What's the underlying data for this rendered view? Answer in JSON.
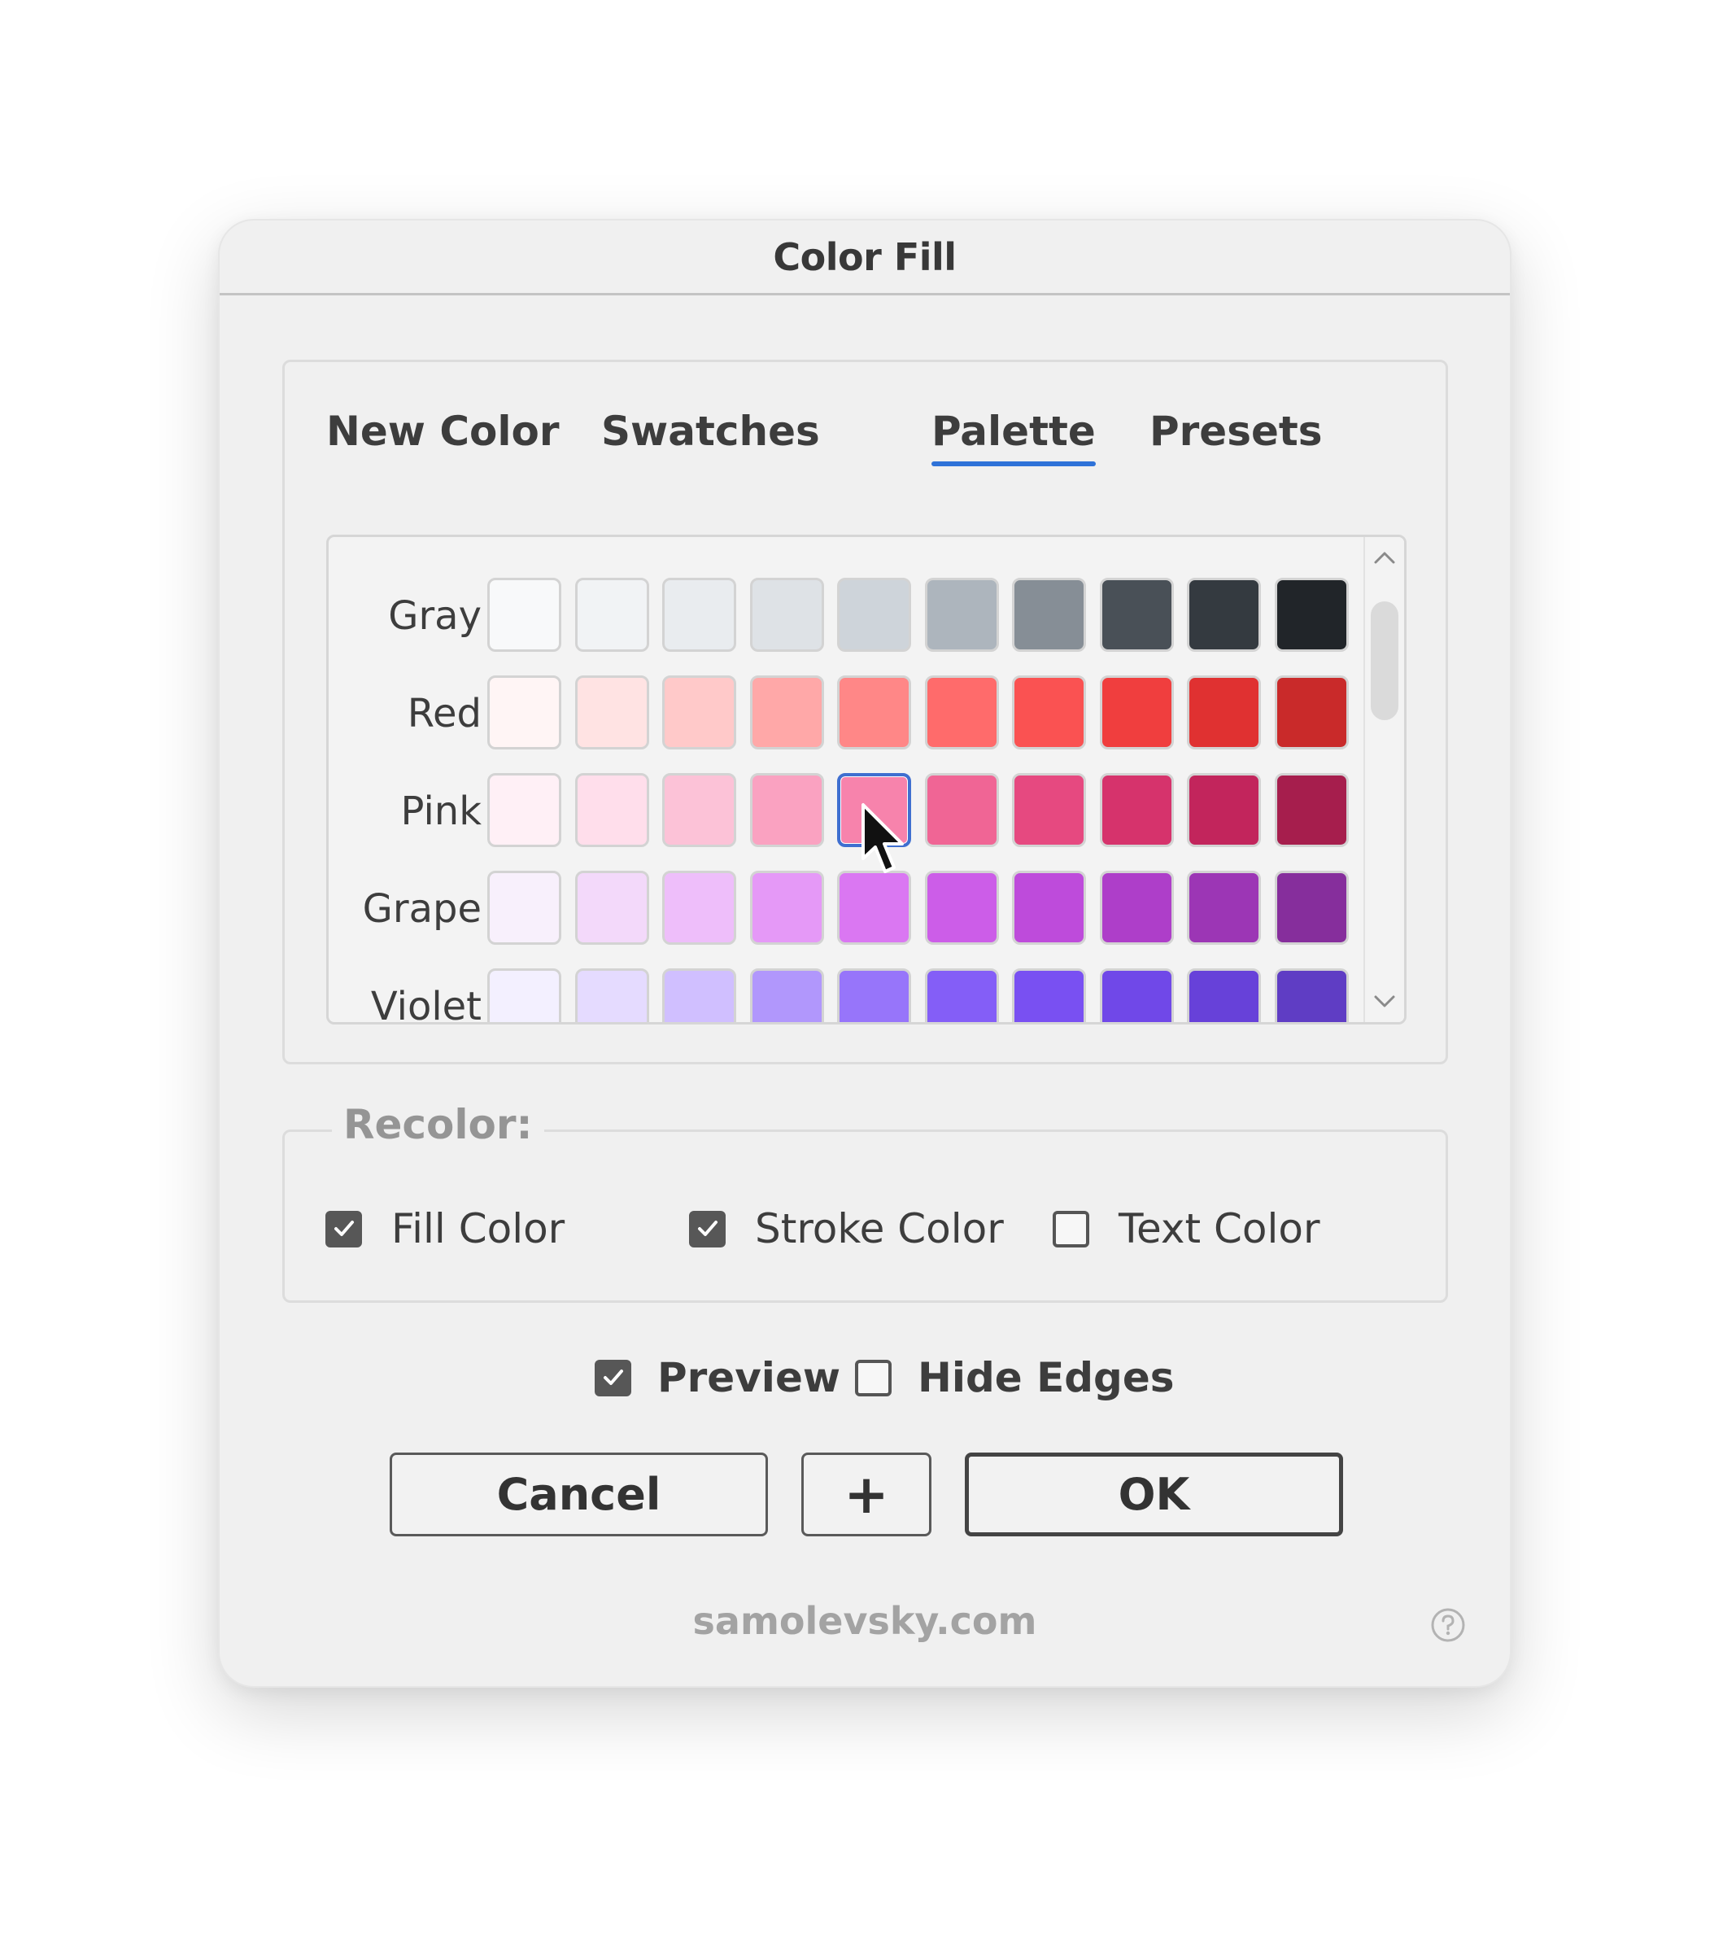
{
  "dialog": {
    "title": "Color Fill"
  },
  "tabs": [
    {
      "label": "New Color",
      "active": false
    },
    {
      "label": "Swatches",
      "active": false
    },
    {
      "label": "Palette",
      "active": true
    },
    {
      "label": "Presets",
      "active": false
    }
  ],
  "palette": {
    "rows": [
      {
        "name": "Gray",
        "colors": [
          "#f8f9fa",
          "#f1f3f5",
          "#e9ecef",
          "#dee2e6",
          "#ced4da",
          "#adb5bd",
          "#868e96",
          "#495057",
          "#343a40",
          "#212529"
        ]
      },
      {
        "name": "Red",
        "colors": [
          "#fff5f5",
          "#ffe3e3",
          "#ffc9c9",
          "#ffa8a8",
          "#ff8787",
          "#ff6b6b",
          "#fa5252",
          "#f03e3e",
          "#e03131",
          "#c92a2a"
        ]
      },
      {
        "name": "Pink",
        "colors": [
          "#fff0f6",
          "#ffdeeb",
          "#fcc2d7",
          "#faa2c1",
          "#f783ac",
          "#f06595",
          "#e64980",
          "#d6336c",
          "#c2255c",
          "#a61e4d"
        ]
      },
      {
        "name": "Grape",
        "colors": [
          "#f8f0fc",
          "#f3d9fa",
          "#eebefa",
          "#e599f7",
          "#da77f2",
          "#cc5de8",
          "#be4bdb",
          "#ae3ec9",
          "#9c36b5",
          "#862e9c"
        ]
      },
      {
        "name": "Violet",
        "colors": [
          "#f3f0ff",
          "#e5dbff",
          "#d0bfff",
          "#b197fc",
          "#9775fa",
          "#845ef7",
          "#7950f2",
          "#7048e8",
          "#6741d9",
          "#5f3dc4"
        ]
      }
    ],
    "selected": {
      "row": 2,
      "col": 4
    }
  },
  "recolor": {
    "legend": "Recolor:",
    "options": [
      {
        "label": "Fill Color",
        "checked": true
      },
      {
        "label": "Stroke Color",
        "checked": true
      },
      {
        "label": "Text Color",
        "checked": false
      }
    ]
  },
  "options": [
    {
      "label": "Preview",
      "checked": true
    },
    {
      "label": "Hide Edges",
      "checked": false
    }
  ],
  "buttons": {
    "cancel": "Cancel",
    "add": "+",
    "ok": "OK"
  },
  "footer": {
    "link": "samolevsky.com",
    "help_icon": "question-circle-icon"
  },
  "cursor": {
    "icon": "arrow-pointer-icon"
  }
}
